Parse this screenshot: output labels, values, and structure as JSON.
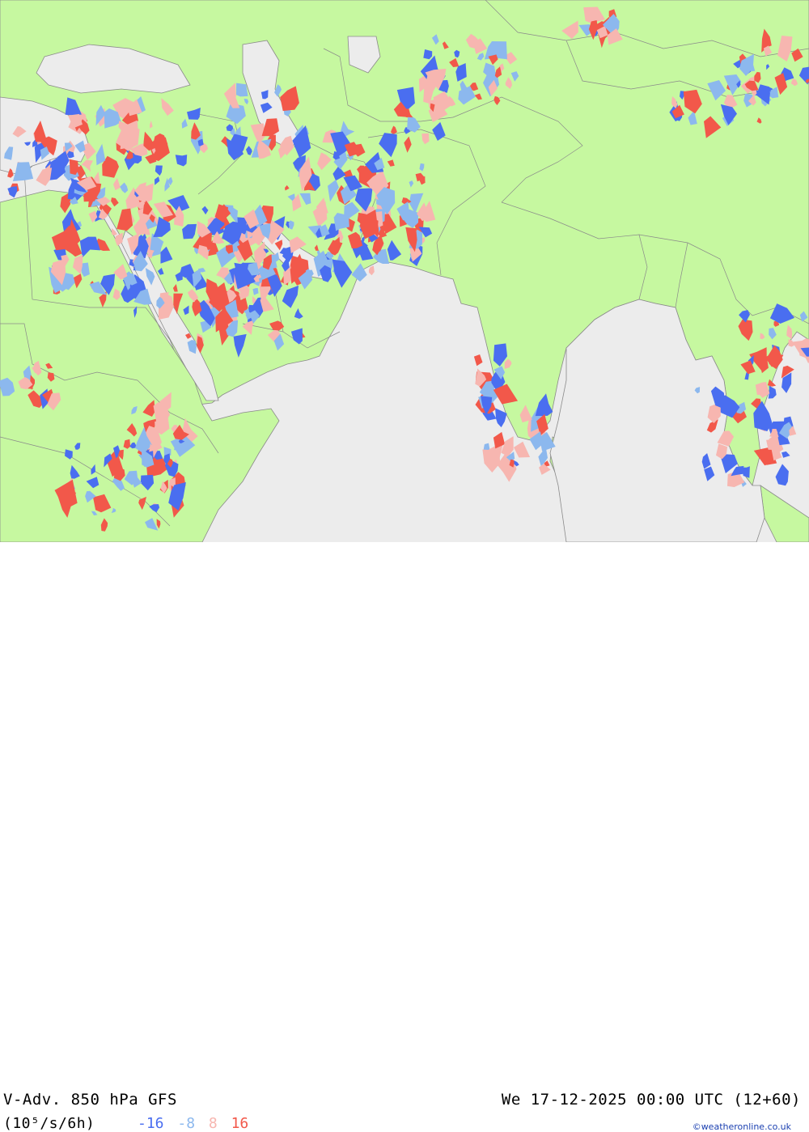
{
  "header": {
    "title": "V-Adv. 850 hPa  GFS",
    "datetime": "We 17-12-2025 00:00 UTC (12+60)",
    "units": "(10⁵/s/6h)"
  },
  "legend": {
    "items": [
      {
        "label": "-16",
        "color": "#4a6ef0"
      },
      {
        "label": "-8",
        "color": "#8cb8ee"
      },
      {
        "label": "8",
        "color": "#f7b6b0"
      },
      {
        "label": "16",
        "color": "#f2584a"
      }
    ]
  },
  "credit": "©weatheronline.co.uk",
  "colors": {
    "land": "#c6f8a0",
    "sea": "#ececec",
    "border": "#8a8a8a",
    "strong_negative": "#4a6ef0",
    "weak_negative": "#8cb8ee",
    "weak_positive": "#f7b6b0",
    "strong_positive": "#f2584a"
  }
}
